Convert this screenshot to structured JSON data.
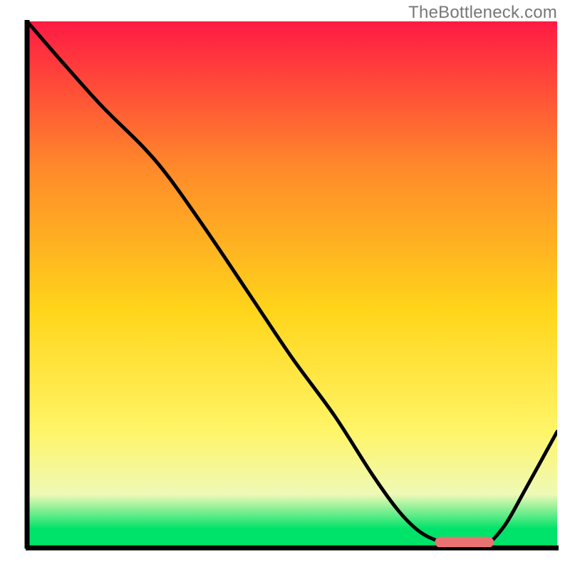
{
  "watermark": "TheBottleneck.com",
  "colors": {
    "axis": "#000000",
    "curve": "#000000",
    "marker_fill": "#e97373",
    "marker_stroke": "#e97373",
    "gradient_top": "#ff1a44",
    "gradient_upper_mid": "#ff8a2a",
    "gradient_mid": "#ffd51a",
    "gradient_lower_mid": "#fff568",
    "gradient_pale": "#eef9b6",
    "gradient_green": "#00e36a"
  },
  "chart_data": {
    "type": "line",
    "title": "",
    "xlabel": "",
    "ylabel": "",
    "xlim": [
      0,
      100
    ],
    "ylim": [
      0,
      100
    ],
    "x": [
      0,
      6,
      14,
      22,
      27,
      34,
      42,
      50,
      58,
      65,
      70,
      74,
      78,
      82,
      86,
      90,
      94,
      100
    ],
    "values": [
      100,
      93,
      84,
      76,
      70,
      60,
      48,
      36,
      25,
      14,
      7,
      3,
      1,
      0,
      0,
      4,
      11,
      22
    ],
    "optimal_range_x": [
      77,
      88
    ],
    "notes": "x is a normalized horizontal axis (0=left plot edge, 100=right). values are percent of plot height (0=bottom axis, 100=top). Curve is a bottleneck-style V with minimum near x≈80–85."
  }
}
